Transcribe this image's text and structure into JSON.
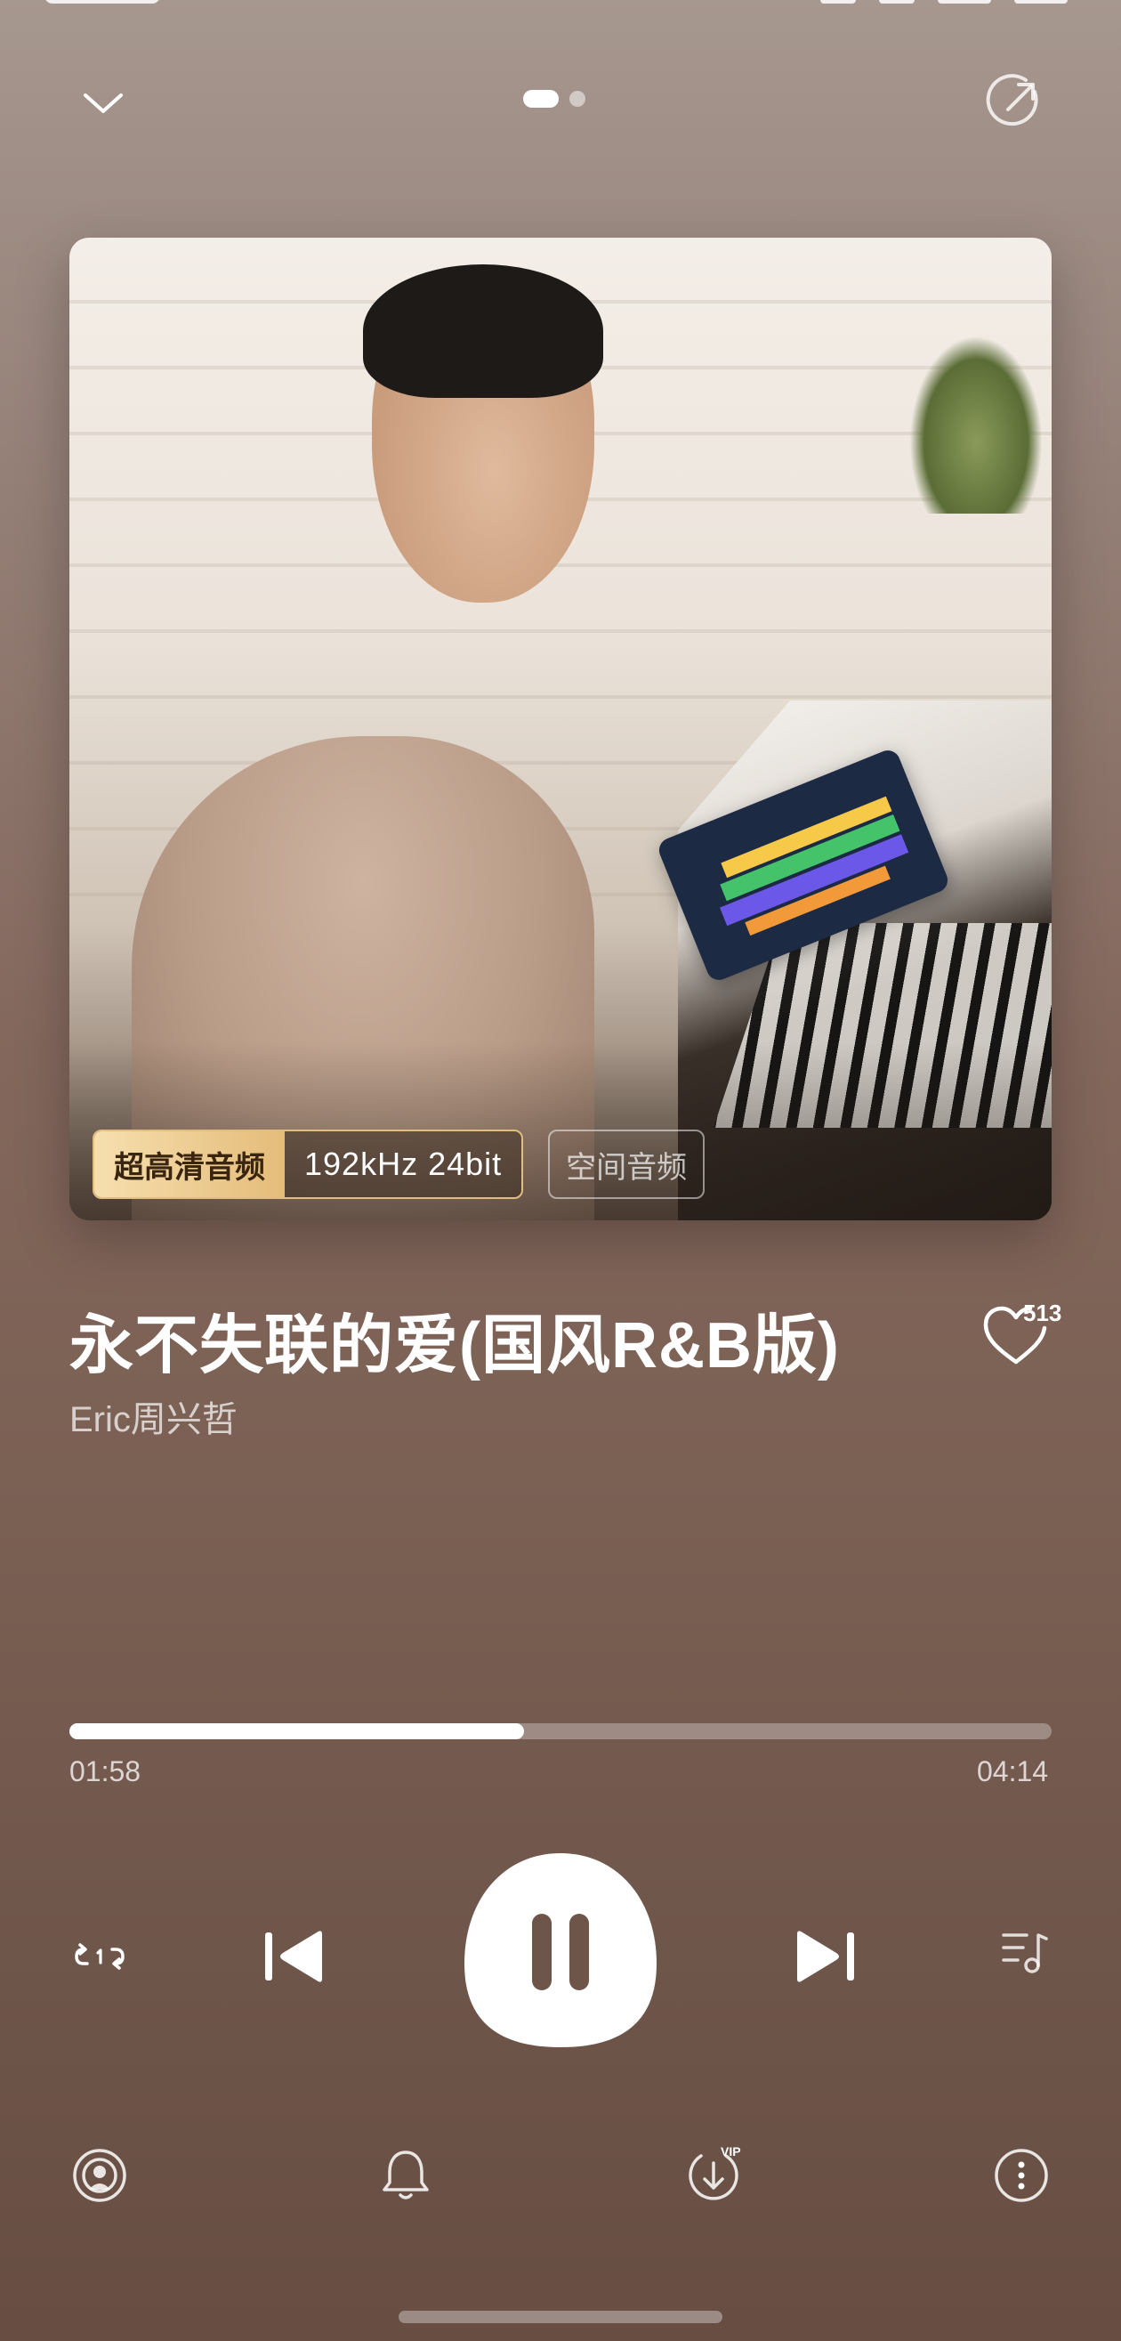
{
  "nav": {
    "collapse_icon": "chevron-down-icon",
    "share_icon": "share-arrow-icon",
    "page_indicator": {
      "pages": 2,
      "active": 1
    }
  },
  "album": {
    "badges": {
      "hq_label": "超高清音频",
      "hq_spec": "192kHz  24bit",
      "spatial": "空间音频"
    }
  },
  "song": {
    "title": "永不失联的爱(国风R&B版)",
    "artist": "Eric周兴哲",
    "like_count": "513"
  },
  "progress": {
    "elapsed": "01:58",
    "total": "04:14",
    "fraction": 0.463
  },
  "controls": {
    "repeat_icon": "repeat-one-icon",
    "prev_icon": "previous-track-icon",
    "play_state": "playing",
    "playpause_icon": "pause-icon",
    "next_icon": "next-track-icon",
    "queue_icon": "playlist-icon"
  },
  "bottom_bar": {
    "items": [
      "cast-icon",
      "bell-icon",
      "vip-download-icon",
      "more-icon"
    ],
    "download_badge": "VIP"
  },
  "colors": {
    "accent_gold": "#e4bc7a",
    "background_top": "#a6978f",
    "background_bottom": "#674d42"
  }
}
